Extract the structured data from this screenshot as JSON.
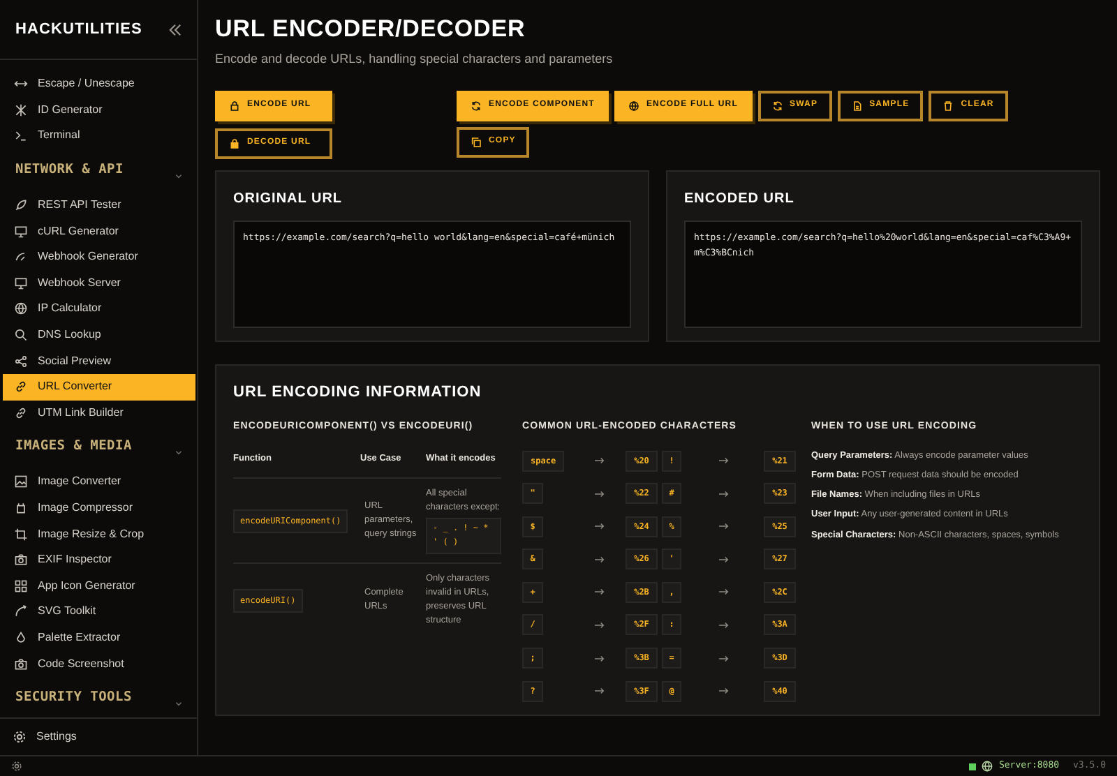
{
  "sidebar": {
    "title": "HACKUTILITIES",
    "sections": [
      {
        "items": [
          {
            "label": "Escape / Unescape",
            "selected": false
          },
          {
            "label": "ID Generator",
            "selected": false
          },
          {
            "label": "Terminal",
            "selected": false
          }
        ]
      },
      {
        "label": "NETWORK & API",
        "items": [
          {
            "label": "REST API Tester",
            "selected": false
          },
          {
            "label": "cURL Generator",
            "selected": false
          },
          {
            "label": "Webhook Generator",
            "selected": false
          },
          {
            "label": "Webhook Server",
            "selected": false
          },
          {
            "label": "IP Calculator",
            "selected": false
          },
          {
            "label": "DNS Lookup",
            "selected": false
          },
          {
            "label": "Social Preview",
            "selected": false
          },
          {
            "label": "URL Converter",
            "selected": true
          },
          {
            "label": "UTM Link Builder",
            "selected": false
          }
        ]
      },
      {
        "label": "IMAGES & MEDIA",
        "items": [
          {
            "label": "Image Converter",
            "selected": false
          },
          {
            "label": "Image Compressor",
            "selected": false
          },
          {
            "label": "Image Resize & Crop",
            "selected": false
          },
          {
            "label": "EXIF Inspector",
            "selected": false
          },
          {
            "label": "App Icon Generator",
            "selected": false
          },
          {
            "label": "SVG Toolkit",
            "selected": false
          },
          {
            "label": "Palette Extractor",
            "selected": false
          },
          {
            "label": "Code Screenshot",
            "selected": false
          }
        ]
      },
      {
        "label": "SECURITY TOOLS"
      }
    ],
    "settings": "Settings"
  },
  "page": {
    "title": "URL ENCODER/DECODER",
    "subtitle": "Encode and decode URLs, handling special characters and parameters"
  },
  "mode_buttons": [
    {
      "label": "ENCODE URL",
      "kind": "filled"
    },
    {
      "label": "DECODE URL",
      "kind": "outline"
    }
  ],
  "action_buttons": [
    {
      "label": "ENCODE COMPONENT",
      "kind": "filled"
    },
    {
      "label": "ENCODE FULL URL",
      "kind": "filled"
    },
    {
      "label": "SWAP",
      "kind": "outline"
    },
    {
      "label": "SAMPLE",
      "kind": "outline"
    },
    {
      "label": "CLEAR",
      "kind": "outline"
    },
    {
      "label": "COPY",
      "kind": "outline"
    }
  ],
  "original": {
    "title": "ORIGINAL URL",
    "value": "https://example.com/search?q=hello world&lang=en&special=café+münich"
  },
  "encoded": {
    "title": "ENCODED URL",
    "value": "https://example.com/search?q=hello%20world&lang=en&special=caf%C3%A9+m%C3%BCnich"
  },
  "info": {
    "title": "URL ENCODING INFORMATION",
    "comparison": {
      "title": "ENCODEURICOMPONENT() VS ENCODEURI()",
      "columns": [
        "Function",
        "Use Case",
        "What it encodes"
      ],
      "rows": [
        {
          "function": "encodeURIComponent()",
          "use_case": "URL parameters, query strings",
          "encodes": "All special characters except:",
          "except": "- _ . ! ~ * ' ( )"
        },
        {
          "function": "encodeURI()",
          "use_case": "Complete URLs",
          "encodes": "Only characters invalid in URLs, preserves URL structure"
        }
      ]
    },
    "characters": {
      "title": "COMMON URL-ENCODED CHARACTERS",
      "pairs": [
        [
          [
            "space",
            "%20"
          ],
          [
            "!",
            "%21"
          ]
        ],
        [
          [
            "\"",
            "%22"
          ],
          [
            "#",
            "%23"
          ]
        ],
        [
          [
            "$",
            "%24"
          ],
          [
            "%",
            "%25"
          ]
        ],
        [
          [
            "&",
            "%26"
          ],
          [
            "'",
            "%27"
          ]
        ],
        [
          [
            "+",
            "%2B"
          ],
          [
            ",",
            "%2C"
          ]
        ],
        [
          [
            "/",
            "%2F"
          ],
          [
            ":",
            "%3A"
          ]
        ],
        [
          [
            ";",
            "%3B"
          ],
          [
            "=",
            "%3D"
          ]
        ],
        [
          [
            "?",
            "%3F"
          ],
          [
            "@",
            "%40"
          ]
        ]
      ]
    },
    "usage": {
      "title": "WHEN TO USE URL ENCODING",
      "lines": [
        "**Query Parameters:** Always encode parameter values",
        "**Form Data:** POST request data should be encoded",
        "**File Names:** When including files in URLs",
        "**User Input:** Any user-generated content in URLs",
        "**Special Characters:** Non-ASCII characters, spaces, symbols"
      ]
    }
  },
  "status_bar": {
    "server": "Server:8080",
    "version": "v3.5.0"
  }
}
